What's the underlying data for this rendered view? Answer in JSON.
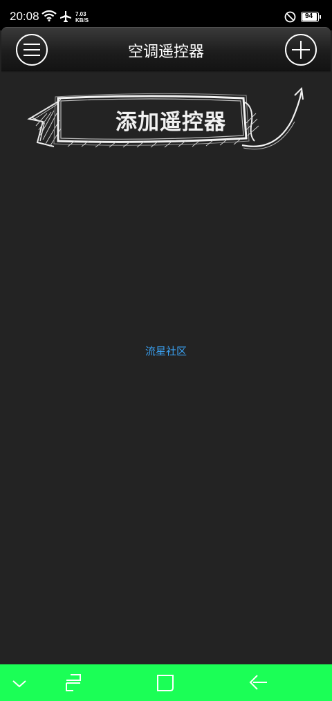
{
  "status_bar": {
    "time": "20:08",
    "net_speed_value": "7.03",
    "net_speed_unit": "KB/S",
    "battery": "94",
    "icons": [
      "wifi-icon",
      "airplane-icon",
      "do-not-disturb-icon",
      "battery-icon"
    ]
  },
  "header": {
    "title": "空调遥控器",
    "menu_icon": "menu-icon",
    "add_icon": "plus-icon"
  },
  "banner": {
    "label": "添加遥控器"
  },
  "footer_link": {
    "text": "流星社区",
    "color": "#3aa0f0"
  },
  "nav_bar": {
    "color": "#1bff56",
    "icons": [
      "chevron-down-icon",
      "recents-icon",
      "home-icon",
      "back-icon"
    ]
  },
  "colors": {
    "background": "#232323",
    "status_bar": "#000000",
    "accent_link": "#3aa0f0",
    "nav_bar": "#1bff56"
  }
}
